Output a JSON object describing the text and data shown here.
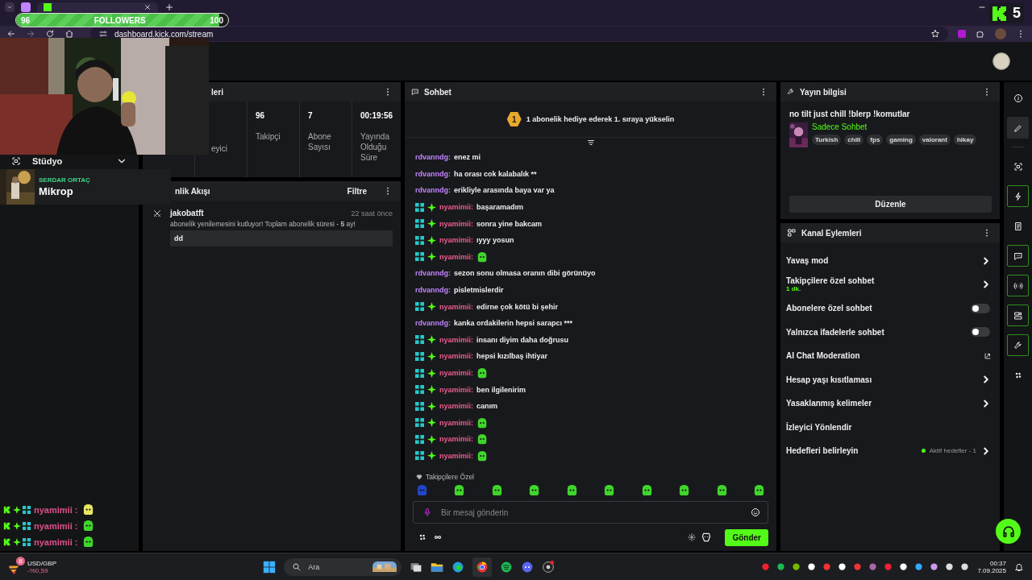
{
  "browser": {
    "url": "dashboard.kick.com/stream"
  },
  "followers_goal": {
    "current": "96",
    "label": "FOLLOWERS",
    "target": "100",
    "level": 0.96
  },
  "kick_overlay": {
    "count": "5"
  },
  "sidebar": {
    "items": [
      {
        "label": "Stüdyo",
        "expanded": false
      }
    ]
  },
  "now_playing": {
    "artist": "SERDAR ORTAÇ",
    "title": "Mikrop"
  },
  "stats_panel": {
    "title": "leri",
    "stats": [
      {
        "label": "eyici"
      },
      {
        "value": "96",
        "label": "Takipçi"
      },
      {
        "value": "7",
        "label": "Abone Sayısı"
      },
      {
        "value": "00:19:56",
        "label": "Yayında Olduğu Süre"
      }
    ]
  },
  "feed_panel": {
    "title": "nlik Akışı",
    "filter": "Filtre",
    "events": [
      {
        "user": "jakobatft",
        "time": "22 saat önce",
        "message": "abonelik yenilemesini kutluyor! Toplam abonelik süresi - **5** ay!",
        "note": "dd"
      }
    ]
  },
  "chat": {
    "title": "Sohbet",
    "pinned": {
      "rank": "1",
      "text": "1 abonelik hediye ederek 1. sıraya yükselin"
    },
    "messages": [
      {
        "kind": "plain",
        "user": "rdvanndg:",
        "text": "enez mi",
        "emote": false
      },
      {
        "kind": "plain",
        "user": "rdvanndg:",
        "text": "ha orası cok kalabalık **",
        "emote": false
      },
      {
        "kind": "plain",
        "user": "rdvanndg:",
        "text": "erikliyle arasında baya var ya",
        "emote": false
      },
      {
        "kind": "badged",
        "user": "nyamimii:",
        "text": "başaramadım",
        "emote": false
      },
      {
        "kind": "badged",
        "user": "nyamimii:",
        "text": "sonra yine bakcam",
        "emote": false
      },
      {
        "kind": "badged",
        "user": "nyamimii:",
        "text": "ıyyy yosun",
        "emote": false
      },
      {
        "kind": "badged",
        "user": "nyamimii:",
        "emote": true
      },
      {
        "kind": "plain",
        "user": "rdvanndg:",
        "text": "sezon sonu olmasa oranın dibi görünüyo",
        "emote": false
      },
      {
        "kind": "plain",
        "user": "rdvanndg:",
        "text": "pisletmislerdir",
        "emote": false
      },
      {
        "kind": "badged",
        "user": "nyamimii:",
        "text": "edirne çok kötü bi şehir",
        "emote": false
      },
      {
        "kind": "plain",
        "user": "rdvanndg:",
        "text": "kanka ordakilerin hepsi sarapcı ***",
        "emote": false
      },
      {
        "kind": "badged",
        "user": "nyamimii:",
        "text": "insanı diyim daha doğrusu",
        "emote": false
      },
      {
        "kind": "badged",
        "user": "nyamimii:",
        "text": "hepsi kızılbaş ihtiyar",
        "emote": false
      },
      {
        "kind": "badged",
        "user": "nyamimii:",
        "emote": true
      },
      {
        "kind": "badged",
        "user": "nyamimii:",
        "text": "ben ilgilenirim",
        "emote": false
      },
      {
        "kind": "badged",
        "user": "nyamimii:",
        "text": "canım",
        "emote": false
      },
      {
        "kind": "badged",
        "user": "nyamimii:",
        "emote": true
      },
      {
        "kind": "badged",
        "user": "nyamimii:",
        "emote": true
      },
      {
        "kind": "badged",
        "user": "nyamimii:",
        "emote": true
      }
    ],
    "emote_bar_label": "Takipçilere Özel",
    "input_placeholder": "Bir mesaj gönderin",
    "send": "Gönder"
  },
  "stream_info": {
    "title": "Yayın bilgisi",
    "stream_title": "no tilt just chill !blerp !komutlar",
    "category": "Sadece Sohbet",
    "tags": [
      "Turkish",
      "chill",
      "fps",
      "gaming",
      "valorant",
      "hikay"
    ],
    "edit": "Düzenle"
  },
  "channel_actions": {
    "title": "Kanal Eylemleri",
    "items": [
      {
        "kind": "link",
        "label": "Yavaş mod"
      },
      {
        "kind": "link",
        "label": "Takipçilere özel sohbet",
        "detail": "1 dk."
      },
      {
        "kind": "toggle",
        "label": "Abonelere özel sohbet",
        "on": false
      },
      {
        "kind": "toggle",
        "label": "Yalnızca ifadelerle sohbet",
        "on": false
      },
      {
        "kind": "external",
        "label": "AI Chat Moderation"
      },
      {
        "kind": "link",
        "label": "Hesap yaşı kısıtlaması"
      },
      {
        "kind": "link",
        "label": "Yasaklanmış kelimeler"
      },
      {
        "kind": "plain",
        "label": "İzleyici Yönlendir"
      },
      {
        "kind": "goal",
        "label": "Hedefleri belirleyin",
        "status": "Aktif hedefler - 1"
      }
    ]
  },
  "rail": [
    {
      "kind": "info",
      "selected": false,
      "outlined": false
    },
    {
      "kind": "pencil",
      "selected": true,
      "outlined": false
    },
    {
      "kind": "scan",
      "selected": false,
      "outlined": false
    },
    {
      "kind": "bolt",
      "selected": false,
      "outlined": true
    },
    {
      "kind": "note",
      "selected": false,
      "outlined": false
    },
    {
      "kind": "chat",
      "selected": false,
      "outlined": true
    },
    {
      "kind": "broadcast",
      "selected": false,
      "outlined": true
    },
    {
      "kind": "camera",
      "selected": false,
      "outlined": true
    },
    {
      "kind": "wrench",
      "selected": false,
      "outlined": true
    },
    {
      "kind": "dots",
      "selected": false,
      "outlined": false
    }
  ],
  "overlay_chat": [
    {
      "user": "nyamimii :"
    },
    {
      "user": "nyamimii :"
    },
    {
      "user": "nyamimii :"
    }
  ],
  "taskbar": {
    "search": "Ara",
    "widget": {
      "symbol": "USD/GBP",
      "change": "-%0,59",
      "badge": "8"
    },
    "time": "00:37",
    "date": "7.09.2025"
  }
}
